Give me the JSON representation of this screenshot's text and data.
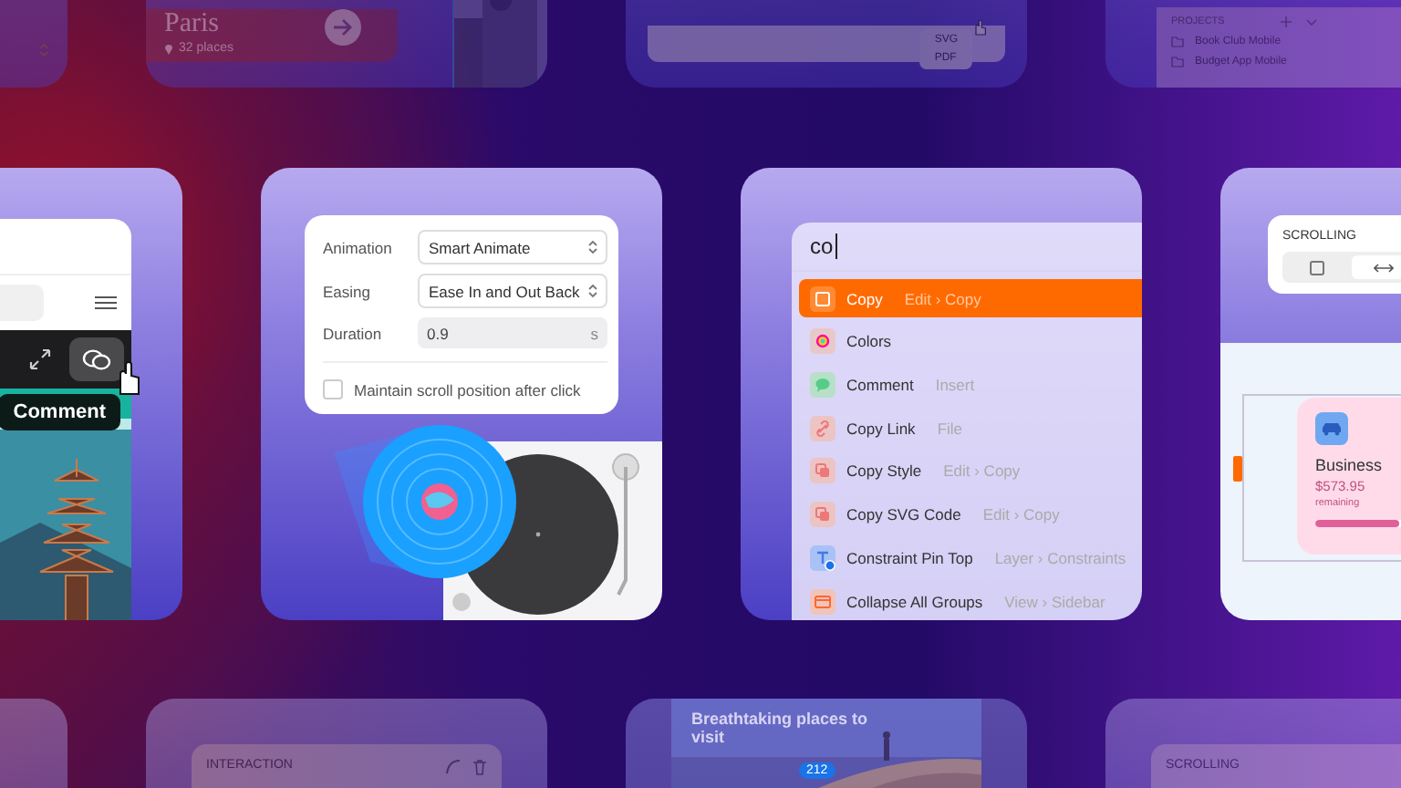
{
  "top_tiles": [
    {
      "kind": "select_stub"
    },
    {
      "kind": "place",
      "title": "Paris",
      "subtitle": "32 places"
    },
    {
      "kind": "export_menu",
      "options": [
        "SVG",
        "PDF"
      ]
    },
    {
      "kind": "projects",
      "heading": "PROJECTS",
      "items": [
        "Book Club Mobile",
        "Budget App Mobile"
      ]
    }
  ],
  "middle_tiles": [
    {
      "kind": "app_preview",
      "tooltip": "Comment"
    },
    {
      "kind": "prototype_settings",
      "fields": [
        {
          "kind": "select",
          "label": "Animation",
          "value": "Smart Animate"
        },
        {
          "kind": "select",
          "label": "Easing",
          "value": "Ease In and Out Back"
        },
        {
          "kind": "number",
          "label": "Duration",
          "value": "0.9",
          "unit": "s"
        }
      ],
      "checkbox": {
        "label": "Maintain scroll position after click",
        "checked": false
      }
    },
    {
      "kind": "command_palette",
      "query": "co",
      "results": [
        {
          "kind": "frame",
          "label": "Copy",
          "path": "Edit › Copy",
          "selected": true
        },
        {
          "kind": "colors",
          "label": "Colors",
          "selected": false
        },
        {
          "kind": "comment",
          "label": "Comment",
          "path": "Insert",
          "selected": false
        },
        {
          "kind": "link",
          "label": "Copy Link",
          "path": "File",
          "selected": false
        },
        {
          "kind": "style",
          "label": "Copy Style",
          "path": "Edit › Copy",
          "selected": false
        },
        {
          "kind": "code",
          "label": "Copy SVG Code",
          "path": "Edit › Copy",
          "selected": false
        },
        {
          "kind": "constraint",
          "label": "Constraint Pin Top",
          "path": "Layer › Constraints",
          "selected": false
        },
        {
          "kind": "groups",
          "label": "Collapse All Groups",
          "path": "View › Sidebar",
          "selected": false
        }
      ]
    },
    {
      "kind": "scrolling",
      "heading": "SCROLLING",
      "options": [
        {
          "kind": "none",
          "selected": false
        },
        {
          "kind": "horizontal",
          "selected": true
        }
      ],
      "card": {
        "title": "Business",
        "amount": "$573.95",
        "caption": "remaining",
        "level": 0.65
      }
    }
  ],
  "bottom_tiles": [
    {
      "kind": "blank"
    },
    {
      "kind": "interaction",
      "heading": "INTERACTION"
    },
    {
      "caption": "Breathtaking places to visit",
      "badge": "212"
    },
    {
      "kind": "scrolling_panel",
      "heading": "SCROLLING"
    }
  ]
}
